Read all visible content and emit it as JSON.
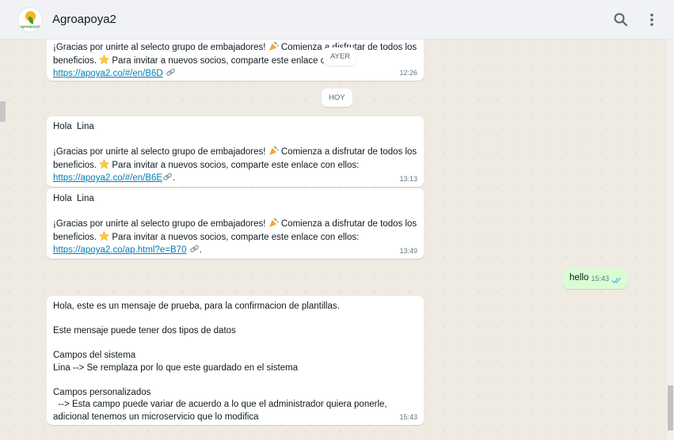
{
  "header": {
    "title": "Agroapoya2",
    "avatar_brand": "agroapoya2",
    "search_icon": "search-icon",
    "menu_icon": "more-vertical-icon"
  },
  "chat": {
    "chips": {
      "yesterday": "AYER",
      "today": "HOY"
    },
    "messages": [
      {
        "line1": "¡Gracias por unirte al selecto grupo de embajadores! ",
        "line1b": " Comienza a disfrutar de todos los",
        "line2": "beneficios. ",
        "line2b": " Para invitar a nuevos socios, comparte este enlace co",
        "link": "https://apoya2.co/#/en/B6D",
        "time": "12:26"
      },
      {
        "greeting": "Hola  Lina",
        "line1": "¡Gracias por unirte al selecto grupo de embajadores! ",
        "line1b": " Comienza a disfrutar de todos los",
        "line2": "beneficios. ",
        "line2b": " Para invitar a nuevos socios, comparte este enlace con ellos:",
        "link": "https://apoya2.co/#/en/B6E",
        "link_suffix": ".",
        "time": "13:13"
      },
      {
        "greeting": "Hola  Lina",
        "line1": "¡Gracias por unirte al selecto grupo de embajadores! ",
        "line1b": " Comienza a disfrutar de todos los",
        "line2": "beneficios. ",
        "line2b": " Para invitar a nuevos socios, comparte este enlace con ellos:",
        "link": "https://apoya2.co/ap.html?e=B70",
        "link_suffix": ".",
        "time": "13:49"
      },
      {
        "text": "hello",
        "time": "15:43",
        "status": "read"
      },
      {
        "text": "Hola, este es un mensaje de prueba, para la confirmacion de plantillas.\n\nEste mensaje puede tener dos tipos de datos\n\nCampos del sistema\nLina --> Se remplaza por lo que este guardado en el sistema\n\nCampos personalizados\n  --> Esta campo puede variar de acuerdo a lo que el administrador quiera ponerle,\nadicional tenemos un microservicio que lo modifica",
        "time": "15:43"
      }
    ]
  },
  "colors": {
    "link": "#027eb5",
    "outgoing_bubble": "#d9fdd3",
    "read_ticks": "#53bdeb",
    "chat_background": "#efeae2"
  }
}
